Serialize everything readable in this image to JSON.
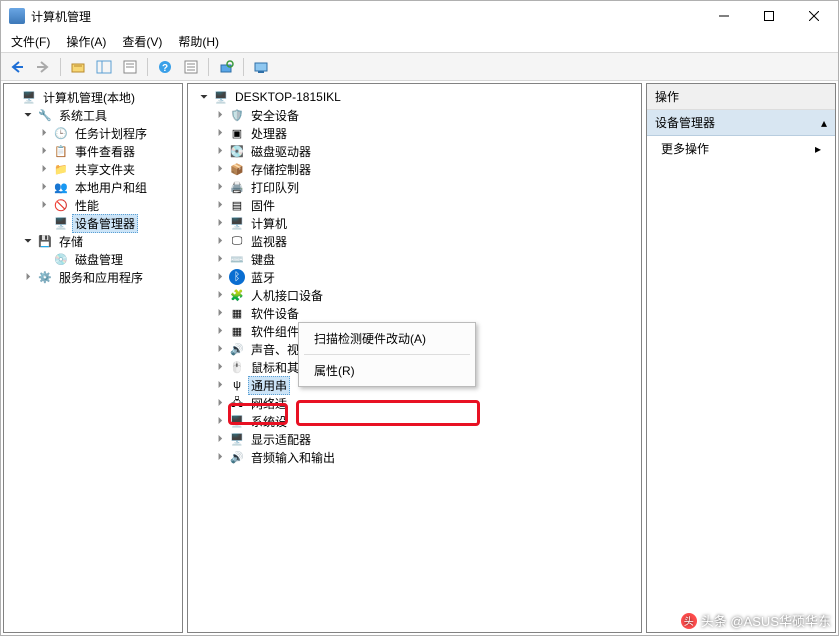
{
  "window": {
    "title": "计算机管理"
  },
  "menubar": {
    "file": "文件(F)",
    "action": "操作(A)",
    "view": "查看(V)",
    "help": "帮助(H)"
  },
  "leftTree": {
    "root": "计算机管理(本地)",
    "sysTools": "系统工具",
    "taskSched": "任务计划程序",
    "eventViewer": "事件查看器",
    "sharedFolders": "共享文件夹",
    "localUsers": "本地用户和组",
    "perf": "性能",
    "devmgr": "设备管理器",
    "storage": "存储",
    "diskMgmt": "磁盘管理",
    "services": "服务和应用程序"
  },
  "devTree": {
    "root": "DESKTOP-1815IKL",
    "security": "安全设备",
    "cpu": "处理器",
    "diskDrives": "磁盘驱动器",
    "storageCtrl": "存储控制器",
    "printers": "打印队列",
    "firmware": "固件",
    "computer": "计算机",
    "monitors": "监视器",
    "keyboards": "键盘",
    "bluetooth": "蓝牙",
    "hid": "人机接口设备",
    "swDevices": "软件设备",
    "swComponents": "软件组件",
    "sound": "声音、视频和游戏控制器",
    "mice": "鼠标和其他指针设备",
    "usb": "通用串",
    "network": "网络适",
    "system": "系统设",
    "display": "显示适配器",
    "audioIO": "音频输入和输出"
  },
  "context": {
    "scan": "扫描检测硬件改动(A)",
    "properties": "属性(R)"
  },
  "actions": {
    "header": "操作",
    "section": "设备管理器",
    "more": "更多操作"
  },
  "watermark": "头条 @ASUS华硕华东"
}
